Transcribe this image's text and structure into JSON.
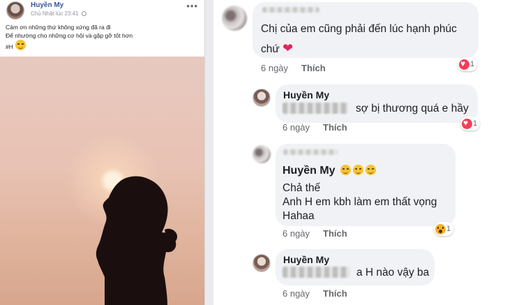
{
  "post": {
    "author": "Huyền My",
    "timestamp": "Chủ Nhật lúc 23:41",
    "more_label": "•••",
    "lines": [
      "Cảm ơn những thứ không xứng đã ra đi",
      "Để nhường cho những cơ hội và gặp gỡ tốt hơn"
    ],
    "hashtag": "#H"
  },
  "comments": [
    {
      "text_line1": "Chị của em cũng phải đến lúc hạnh phúc",
      "text_line2": "chứ",
      "heart": "❤",
      "time": "6 ngày",
      "action": "Thích",
      "reaction_count": "1"
    },
    {
      "author": "Huyền My",
      "text": "sợ bị thương quá e hầy",
      "time": "6 ngày",
      "action": "Thích",
      "reaction_count": "1"
    },
    {
      "author": "Huyền My",
      "lines": [
        "Chả thế",
        "Anh H em kbh làm em thất vọng",
        "Hahaa"
      ],
      "time": "6 ngày",
      "action": "Thích",
      "reaction_count": "1"
    },
    {
      "author": "Huyền My",
      "text": "a H nào vậy ba",
      "time": "6 ngày",
      "action": "Thích"
    }
  ],
  "colors": {
    "link_blue": "#385898",
    "bubble_bg": "#f0f2f5",
    "meta_gray": "#65676b",
    "heart_red": "#f33e58",
    "wow_yellow": "#f7b125"
  },
  "icons": [
    "globe-icon",
    "more-icon",
    "heart-reaction-icon",
    "wow-reaction-icon",
    "smile-emoji-icon"
  ]
}
